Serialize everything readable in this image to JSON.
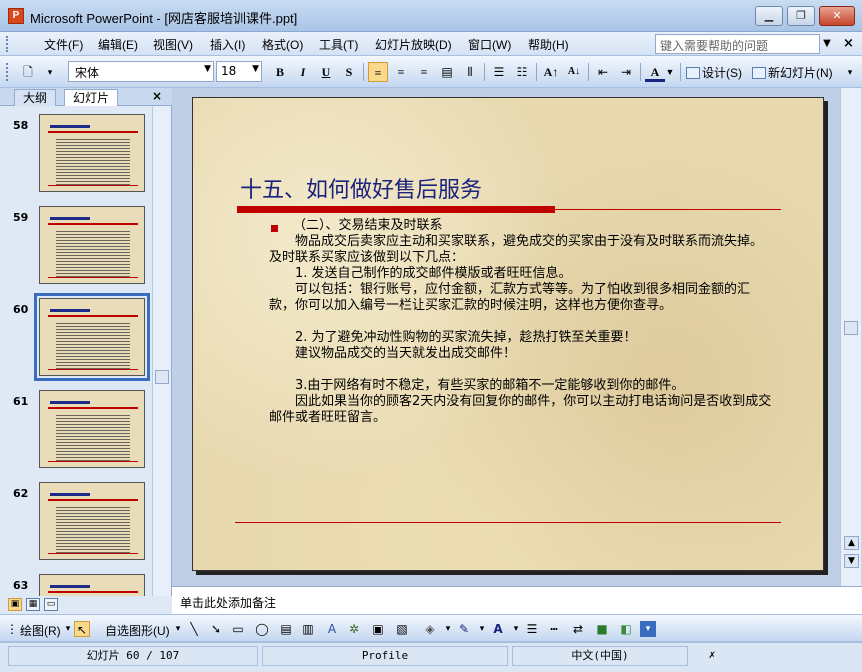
{
  "window": {
    "title": "Microsoft PowerPoint - [网店客服培训课件.ppt]",
    "app_icon": "powerpoint-icon",
    "minimize_icon": "minimize-icon",
    "maximize_icon": "restore-icon",
    "close_icon": "close-icon"
  },
  "menu": {
    "items": [
      "文件(F)",
      "编辑(E)",
      "视图(V)",
      "插入(I)",
      "格式(O)",
      "工具(T)",
      "幻灯片放映(D)",
      "窗口(W)",
      "帮助(H)"
    ],
    "help_placeholder": "键入需要帮助的问题",
    "close_doc": "×"
  },
  "toolbar": {
    "font_name": "宋体",
    "font_size": "18",
    "bold": "B",
    "italic": "I",
    "underline": "U",
    "shadow": "S",
    "design_label": "设计(S)",
    "new_slide_label": "新幻灯片(N)"
  },
  "left_pane": {
    "tab_outline": "大纲",
    "tab_slides": "幻灯片",
    "close": "×",
    "slides": [
      {
        "num": "58",
        "selected": false
      },
      {
        "num": "59",
        "selected": false
      },
      {
        "num": "60",
        "selected": true
      },
      {
        "num": "61",
        "selected": false
      },
      {
        "num": "62",
        "selected": false
      },
      {
        "num": "63",
        "selected": false
      }
    ]
  },
  "slide": {
    "title": "十五、如何做好售后服务",
    "heading": "（二）、交易结束及时联系",
    "paragraphs": [
      "　　物品成交后卖家应主动和买家联系，避免成交的买家由于没有及时联系而流失掉。及时联系买家应该做到以下几点：",
      "　　1. 发送自己制作的成交邮件模版或者旺旺信息。",
      "　　可以包括：银行账号，应付金额，汇款方式等等。为了怕收到很多相同金额的汇款，你可以加入编号一栏让买家汇款的时候注明，这样也方便你查寻。",
      "",
      "　　2. 为了避免冲动性购物的买家流失掉，趁热打铁至关重要！",
      "　　建议物品成交的当天就发出成交邮件！",
      "",
      "　　3.由于网络有时不稳定，有些买家的邮箱不一定能够收到你的邮件。",
      "　　因此如果当你的顾客2天内没有回复你的邮件，你可以主动打电话询问是否收到成交邮件或者旺旺留言。"
    ]
  },
  "notes": {
    "placeholder": "单击此处添加备注"
  },
  "drawing_toolbar": {
    "draw_label": "绘图(R)",
    "autoshapes_label": "自选图形(U)"
  },
  "status": {
    "slide_pos": "幻灯片 60 / 107",
    "design": "Profile",
    "language": "中文(中国)"
  },
  "colors": {
    "slide_title": "#1a237e",
    "accent_red": "#c00000",
    "slide_bg": "#e8d9b0"
  }
}
